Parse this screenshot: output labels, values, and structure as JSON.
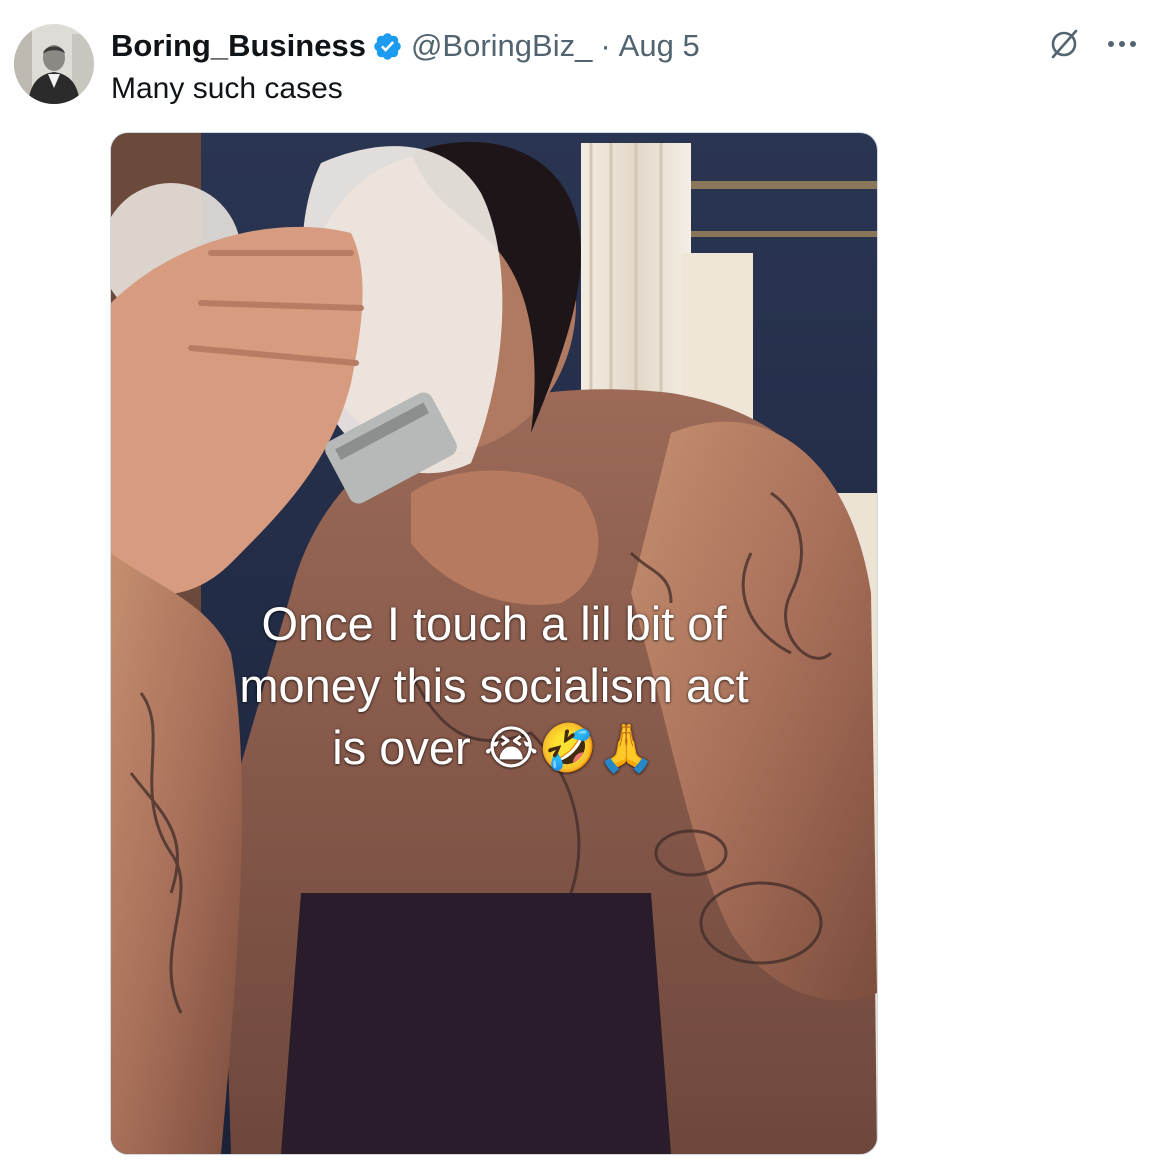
{
  "tweet": {
    "author": {
      "display_name": "Boring_Business",
      "handle": "@BoringBiz_",
      "verified_icon": "verified-badge-icon"
    },
    "separator": "·",
    "date": "Aug 5",
    "text": "Many such cases",
    "actions": {
      "grok_icon": "grok-icon",
      "more_icon": "more-options-icon"
    },
    "media": {
      "caption_lines": [
        "Once I touch a lil bit of",
        "money this socialism act",
        "is over 😭🤣🙏"
      ]
    }
  },
  "colors": {
    "primary_text": "#0f1419",
    "secondary_text": "#536471",
    "verified_blue": "#1d9bf0",
    "media_border": "#cfd9de"
  }
}
